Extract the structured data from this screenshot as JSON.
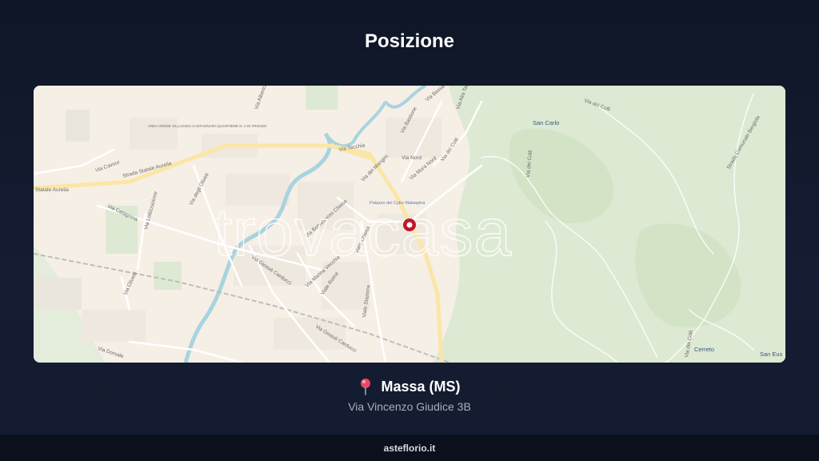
{
  "header": {
    "title": "Posizione"
  },
  "map": {
    "watermark": "trovacasa",
    "labels": {
      "san_carlo": "San Carlo",
      "cerreto": "Cerreto",
      "san_eus": "San Eus",
      "strada_statale_aurelia": "Strada Statale Aurelia",
      "statale_aurelia": "Statale Aurelia",
      "via_cavour": "Via Cavour",
      "via_tecchia": "Via Tecchia",
      "via_degli_oliveti": "Via degli Oliveti",
      "via_lottizzazione": "Via Lottizzazione",
      "via_catagnina": "Via Catagnina",
      "via_olivetti": "Via Olivetti",
      "via_giosue_carducci": "Via Giosuè Carducci",
      "via_giosue_carducci_2": "Via Giosuè Carducci",
      "via_marina_vecchia": "Via Marina Vecchia",
      "viale_roma": "Viale Roma",
      "viale_stazione": "Viale Stazione",
      "viale_chiesa": "Viale Chiesa",
      "via_dorsale": "Via Dorsale",
      "via_bassa_tambura": "Via Bassa Tambura",
      "via_alta_tambura": "Via Alta Tambura",
      "via_dei_colli": "Via dei Colli",
      "via_dei_colli_2": "Via dei Colli",
      "via_nord": "Via Nord",
      "via_mura_nord": "Via Mura Nord",
      "via_dei_mangini": "Via dei Mangini",
      "via_bastione": "Via Bastione",
      "via_alberica": "Via Alberica",
      "via_bonaccorso": "Via Bonaccorso Chiesa",
      "palazzo_ducale": "Palazzo dei Cybo Malaspina",
      "via_comunale": "Strada Comunale Bergiola",
      "area_verde": "AREA VERDE VILLAGGIO CASTAGNARA QUARTIERE N. 2 DI FRIGIDO"
    }
  },
  "location": {
    "pin_icon": "round-pushpin-icon",
    "city": "Massa (MS)",
    "address": "Via Vincenzo Giudice 3B"
  },
  "footer": {
    "site": "asteflorio.it"
  },
  "colors": {
    "background": "#131b2f",
    "map_land": "#f6efe6",
    "map_green": "#dde9d3",
    "river": "#a9d3df",
    "marker": "#c0162c"
  }
}
